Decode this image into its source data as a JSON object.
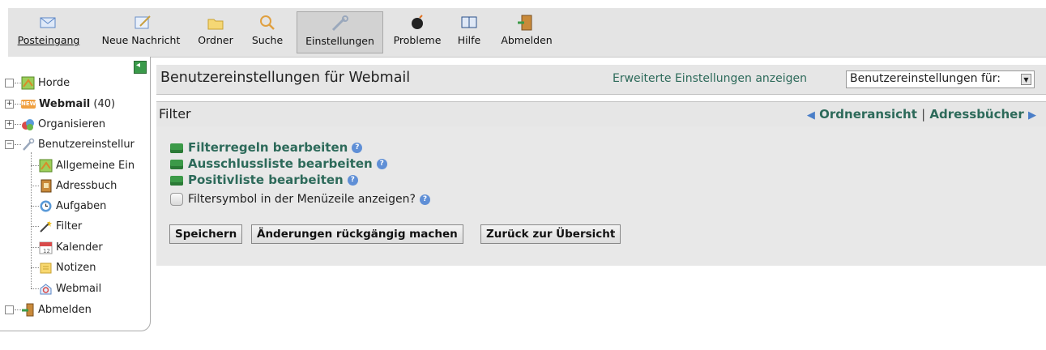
{
  "toolbar": {
    "items": [
      {
        "label": "Posteingang",
        "icon": "envelope-icon"
      },
      {
        "label": "Neue Nachricht",
        "icon": "compose-icon"
      },
      {
        "label": "Ordner",
        "icon": "folder-icon"
      },
      {
        "label": "Suche",
        "icon": "magnifier-icon"
      },
      {
        "label": "Einstellungen",
        "icon": "wrench-icon",
        "active": true
      },
      {
        "label": "Probleme",
        "icon": "bomb-icon"
      },
      {
        "label": "Hilfe",
        "icon": "book-icon"
      },
      {
        "label": "Abmelden",
        "icon": "exit-door-icon"
      }
    ]
  },
  "sidebar": {
    "items": [
      {
        "label": "Horde"
      },
      {
        "label": "Webmail",
        "count": "(40)",
        "badge": "NEW"
      },
      {
        "label": "Organisieren"
      },
      {
        "label": "Benutzereinstellur"
      },
      {
        "label": "Allgemeine Ein"
      },
      {
        "label": "Adressbuch"
      },
      {
        "label": "Aufgaben"
      },
      {
        "label": "Filter"
      },
      {
        "label": "Kalender"
      },
      {
        "label": "Notizen"
      },
      {
        "label": "Webmail"
      },
      {
        "label": "Abmelden"
      }
    ]
  },
  "header": {
    "title": "Benutzereinstellungen für Webmail",
    "advanced_link": "Erweiterte Einstellungen anzeigen",
    "scope_select_value": "Benutzereinstellungen für:"
  },
  "section": {
    "title": "Filter",
    "nav_folder": "Ordneransicht",
    "nav_sep": "|",
    "nav_addressbooks": "Adressbücher"
  },
  "options": {
    "links": [
      "Filterregeln bearbeiten",
      "Ausschlussliste bearbeiten",
      "Positivliste bearbeiten"
    ],
    "checkbox_label": "Filtersymbol in der Menüzeile anzeigen?"
  },
  "buttons": {
    "save": "Speichern",
    "undo": "Änderungen rückgängig machen",
    "back": "Zurück zur Übersicht"
  },
  "colors": {
    "link": "#2d6a5a",
    "header_bg": "#e6e6e6",
    "toolbar_bg": "#e4e4e4"
  }
}
